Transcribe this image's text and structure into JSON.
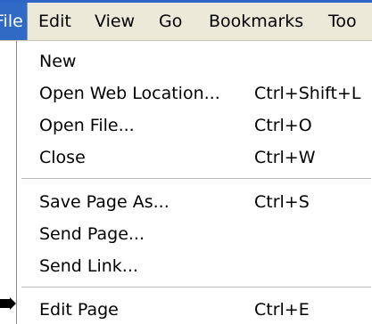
{
  "menubar": {
    "file": "File",
    "edit": "Edit",
    "view": "View",
    "go": "Go",
    "bookmarks": "Bookmarks",
    "tools": "Too"
  },
  "file_menu": {
    "new": {
      "label": "New",
      "shortcut": ""
    },
    "open_location": {
      "label": "Open Web Location...",
      "shortcut": "Ctrl+Shift+L"
    },
    "open_file": {
      "label": "Open File...",
      "shortcut": "Ctrl+O"
    },
    "close": {
      "label": "Close",
      "shortcut": "Ctrl+W"
    },
    "save_page_as": {
      "label": "Save Page As...",
      "shortcut": "Ctrl+S"
    },
    "send_page": {
      "label": "Send Page...",
      "shortcut": ""
    },
    "send_link": {
      "label": "Send Link...",
      "shortcut": ""
    },
    "edit_page": {
      "label": "Edit Page",
      "shortcut": "Ctrl+E"
    }
  },
  "colors": {
    "menubar_bg": "#ece9d8",
    "active_bg": "#316ac5",
    "menu_bg": "#ffffff"
  },
  "icons": {
    "pointer": "arrow-icon"
  }
}
